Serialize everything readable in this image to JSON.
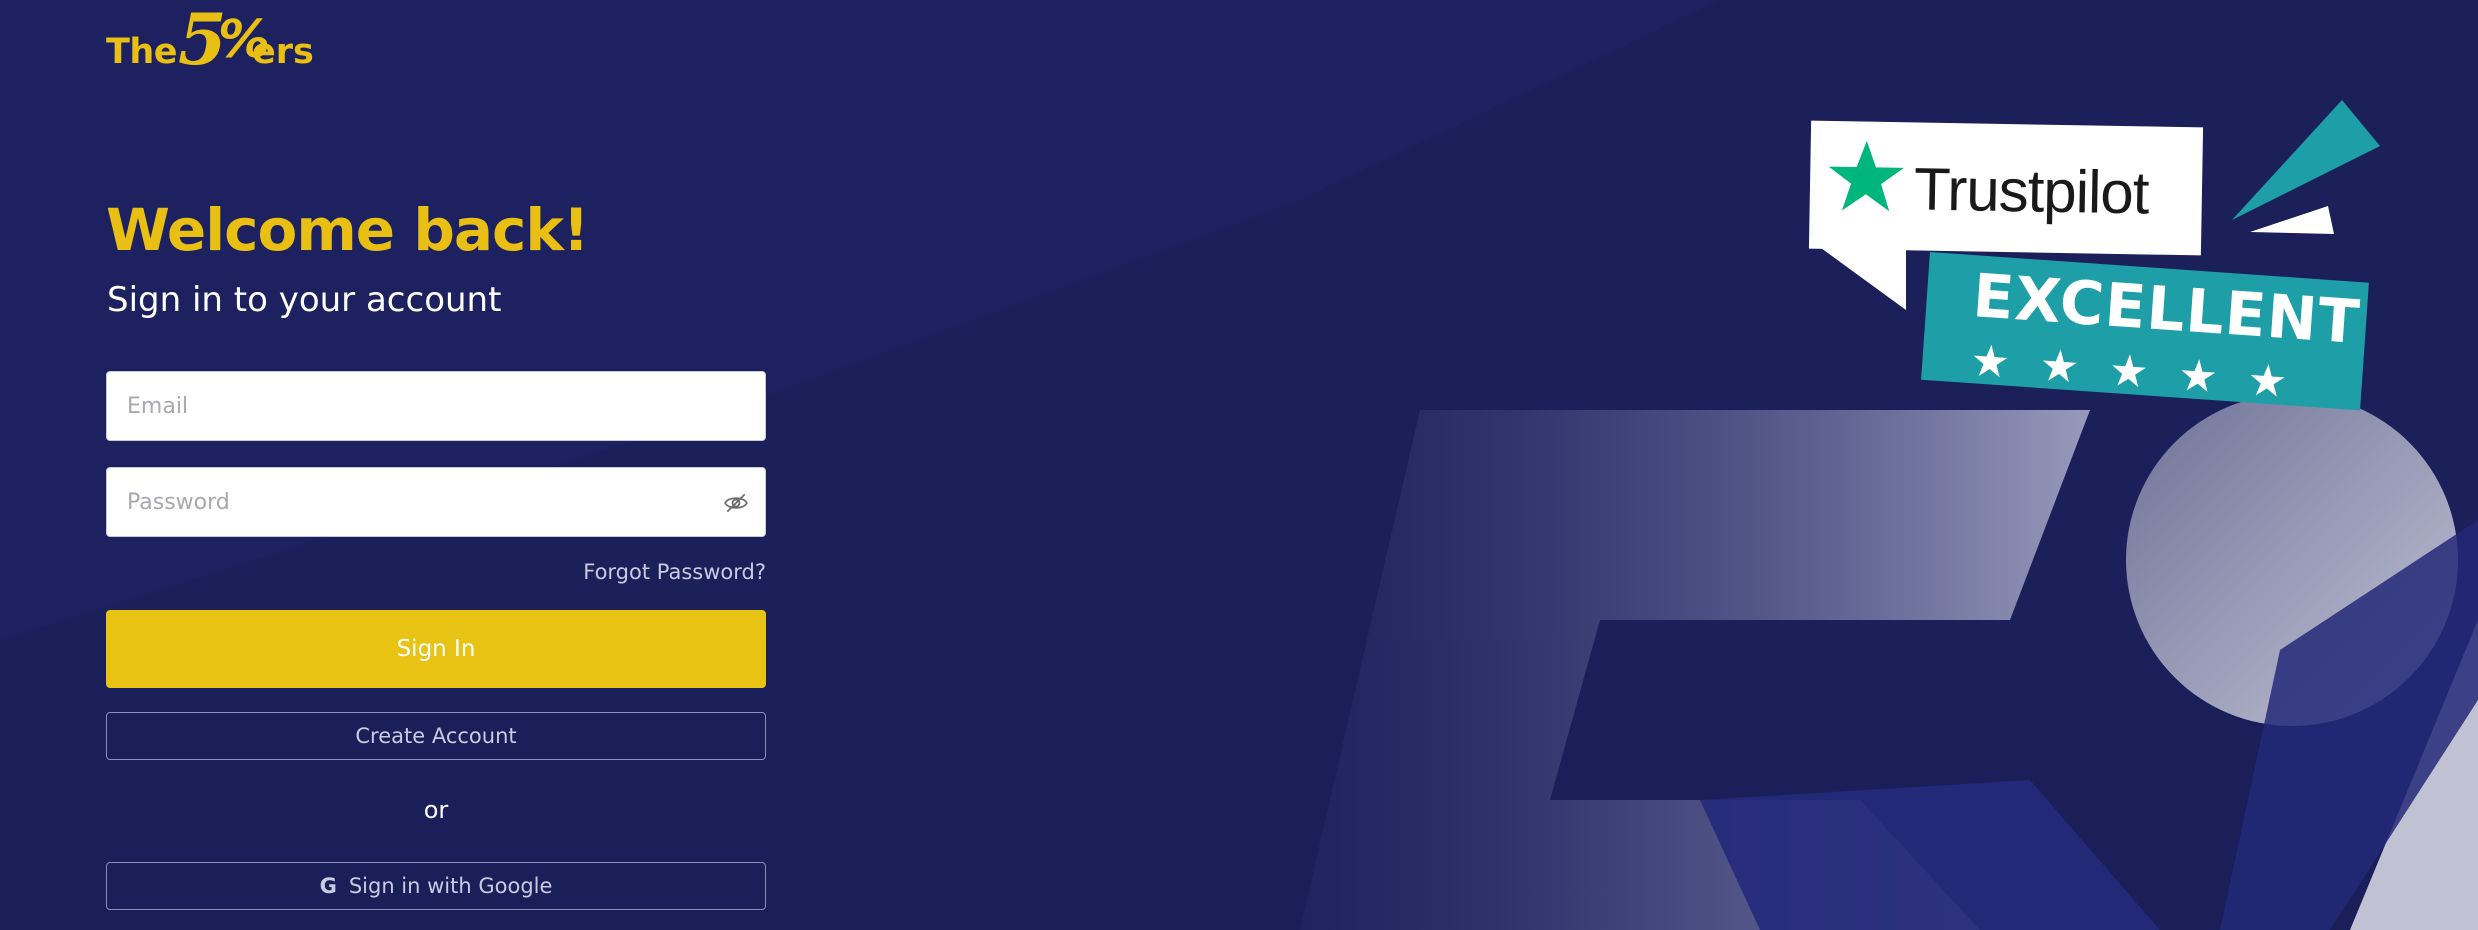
{
  "brand": {
    "the": "The",
    "five": "5",
    "percent": "%",
    "ers": "ers"
  },
  "header": {
    "title": "Welcome back!",
    "subtitle": "Sign in to your account"
  },
  "form": {
    "email_placeholder": "Email",
    "email_value": "",
    "password_placeholder": "Password",
    "password_value": "",
    "forgot_label": "Forgot Password?",
    "signin_label": "Sign In",
    "create_label": "Create Account",
    "or_label": "or",
    "google_label": "Sign in with Google",
    "google_icon": "G"
  },
  "badge": {
    "brand": "Trustpilot",
    "rating_text": "EXCELLENT",
    "stars": "★★★★★",
    "rating_stars": 5
  },
  "colors": {
    "background": "#1b1f5c",
    "accent": "#e8c313",
    "trustpilot_green": "#00b67a",
    "badge_teal": "#1e9fa7"
  },
  "icons": {
    "password_toggle": "eye-slash-icon",
    "google": "google-icon",
    "trustpilot": "trustpilot-star-icon"
  }
}
